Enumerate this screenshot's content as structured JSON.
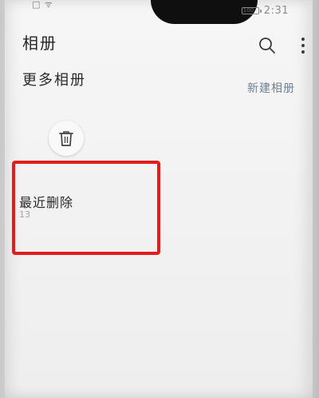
{
  "status_bar": {
    "left_text": "□ ᯤ",
    "battery_text": "100",
    "time": "2:31"
  },
  "header": {
    "title": "相册",
    "search_icon": "search-icon",
    "more_icon": "more-vert-icon"
  },
  "section": {
    "title": "更多相册",
    "new_album_label": "新建相册"
  },
  "albums": [
    {
      "label": "最近删除",
      "count": "13",
      "icon": "trash-icon",
      "highlighted": true
    }
  ],
  "colors": {
    "highlight": "#e31c1c",
    "link": "#6f7f95"
  }
}
